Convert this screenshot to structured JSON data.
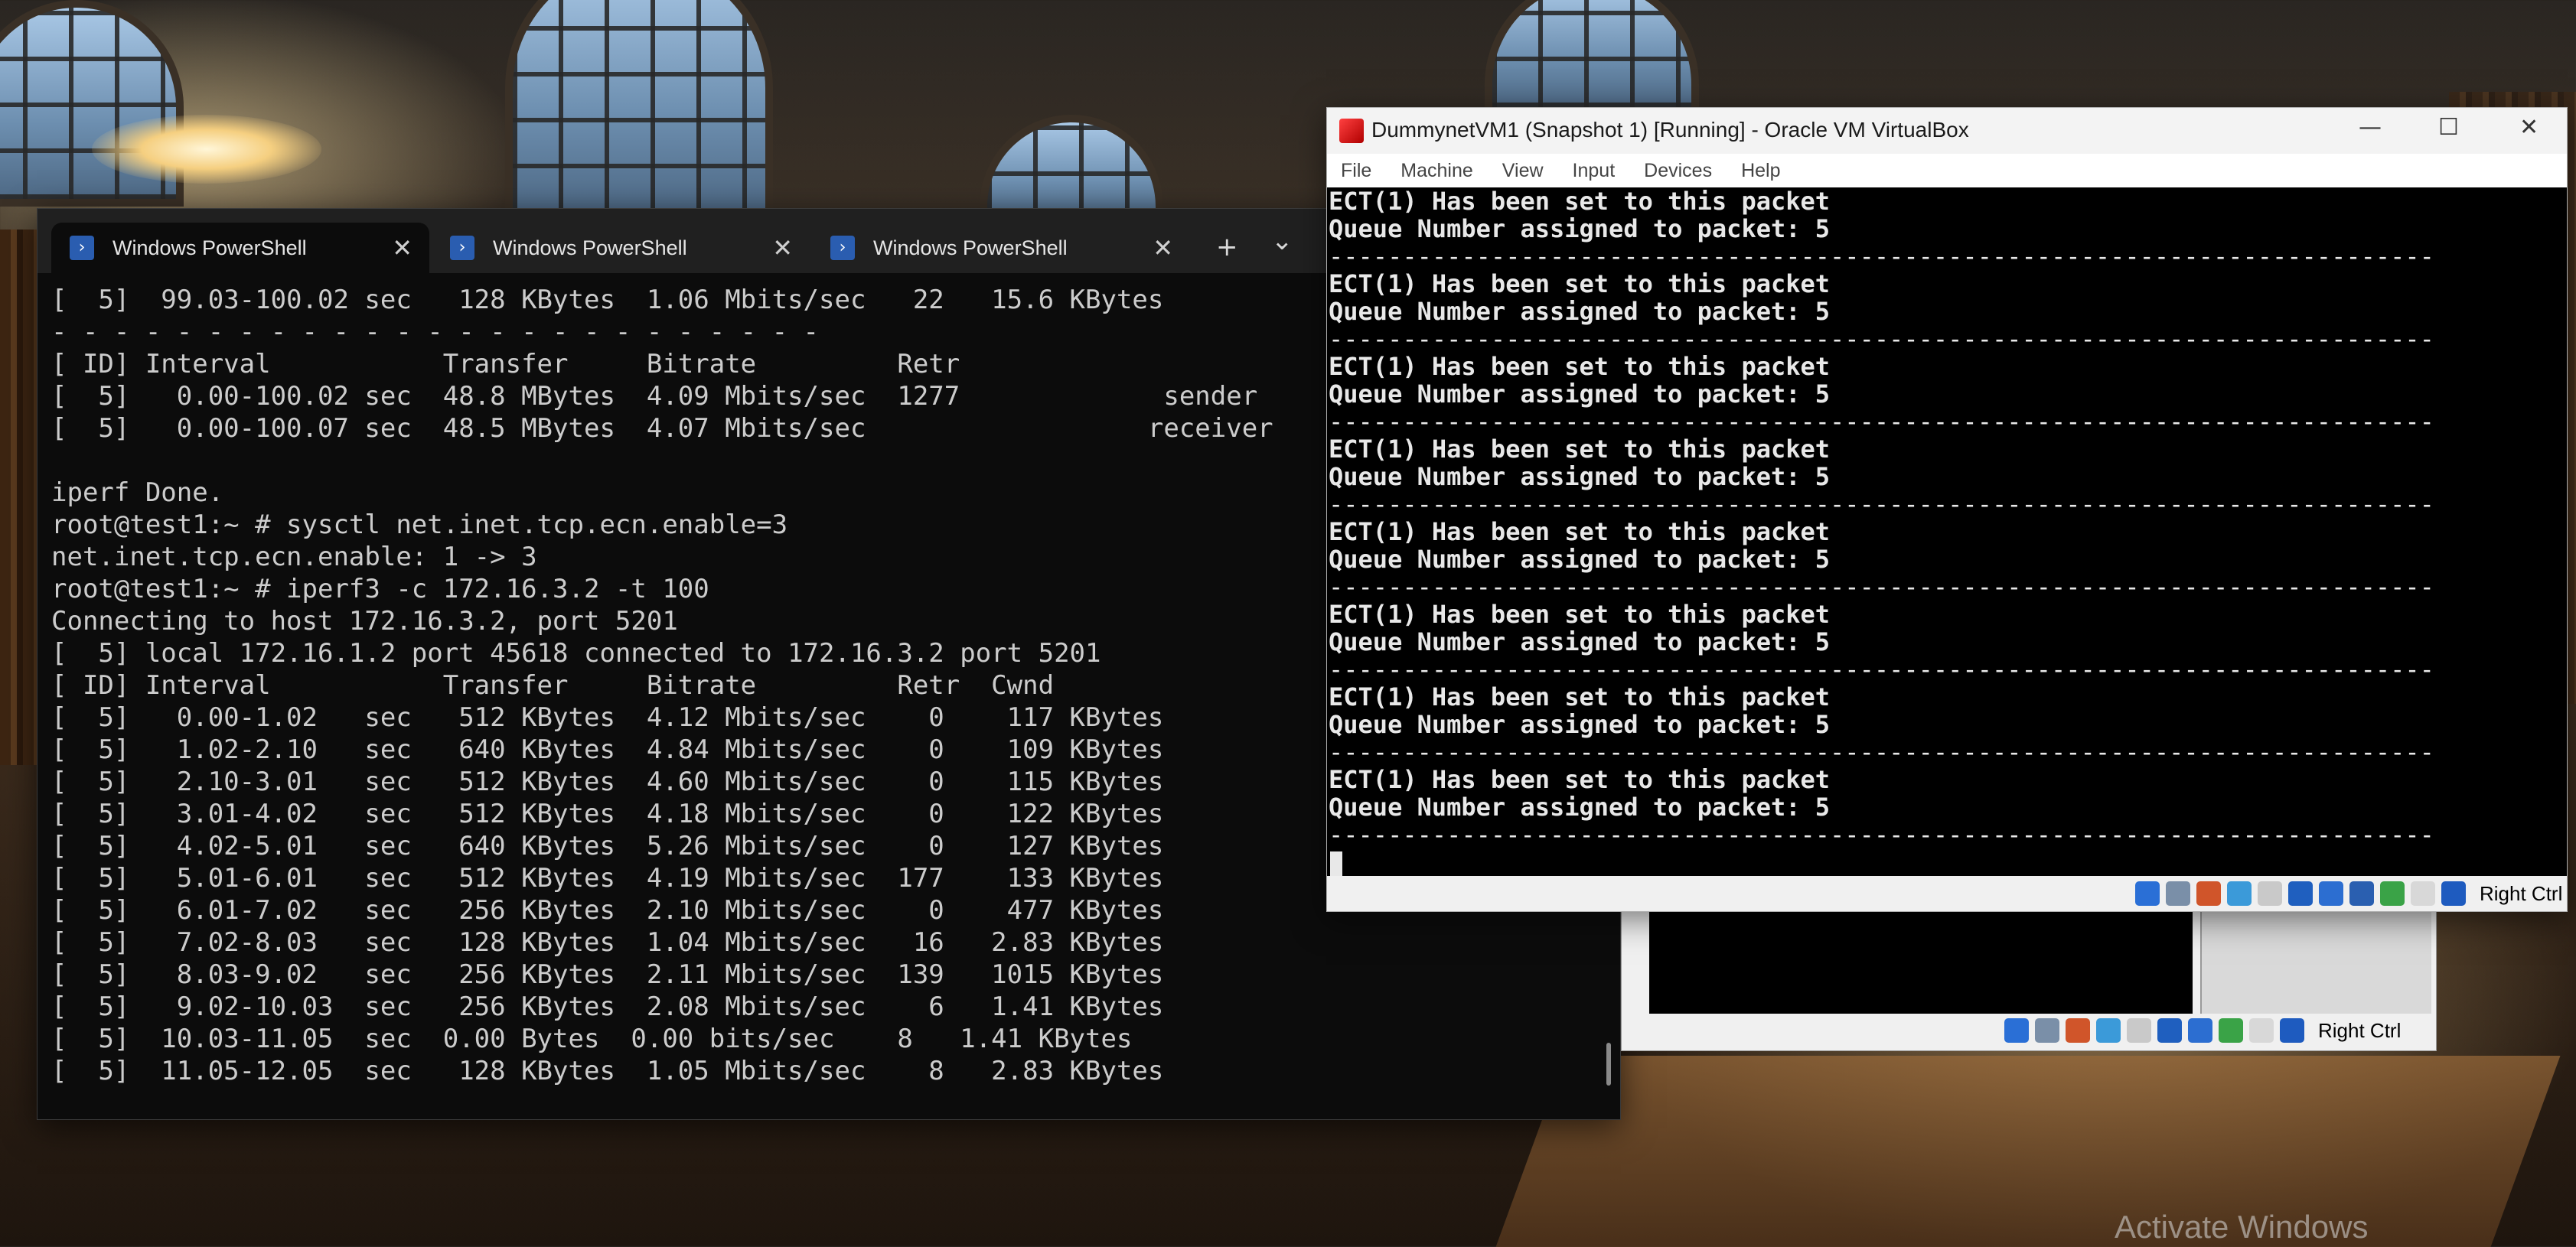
{
  "desktop": {
    "watermark": "Activate Windows"
  },
  "terminal": {
    "tabs": [
      {
        "label": "Windows PowerShell",
        "active": true
      },
      {
        "label": "Windows PowerShell",
        "active": false
      },
      {
        "label": "Windows PowerShell",
        "active": false
      }
    ],
    "new_tab": "+",
    "dropdown": "⌄",
    "lines": [
      "[  5]  99.03-100.02 sec   128 KBytes  1.06 Mbits/sec   22   15.6 KBytes",
      "- - - - - - - - - - - - - - - - - - - - - - - - -",
      "[ ID] Interval           Transfer     Bitrate         Retr",
      "[  5]   0.00-100.02 sec  48.8 MBytes  4.09 Mbits/sec  1277             sender",
      "[  5]   0.00-100.07 sec  48.5 MBytes  4.07 Mbits/sec                  receiver",
      "",
      "iperf Done.",
      "root@test1:~ # sysctl net.inet.tcp.ecn.enable=3",
      "net.inet.tcp.ecn.enable: 1 -> 3",
      "root@test1:~ # iperf3 -c 172.16.3.2 -t 100",
      "Connecting to host 172.16.3.2, port 5201",
      "[  5] local 172.16.1.2 port 45618 connected to 172.16.3.2 port 5201",
      "[ ID] Interval           Transfer     Bitrate         Retr  Cwnd",
      "[  5]   0.00-1.02   sec   512 KBytes  4.12 Mbits/sec    0    117 KBytes",
      "[  5]   1.02-2.10   sec   640 KBytes  4.84 Mbits/sec    0    109 KBytes",
      "[  5]   2.10-3.01   sec   512 KBytes  4.60 Mbits/sec    0    115 KBytes",
      "[  5]   3.01-4.02   sec   512 KBytes  4.18 Mbits/sec    0    122 KBytes",
      "[  5]   4.02-5.01   sec   640 KBytes  5.26 Mbits/sec    0    127 KBytes",
      "[  5]   5.01-6.01   sec   512 KBytes  4.19 Mbits/sec  177    133 KBytes",
      "[  5]   6.01-7.02   sec   256 KBytes  2.10 Mbits/sec    0    477 KBytes",
      "[  5]   7.02-8.03   sec   128 KBytes  1.04 Mbits/sec   16   2.83 KBytes",
      "[  5]   8.03-9.02   sec   256 KBytes  2.11 Mbits/sec  139   1015 KBytes",
      "[  5]   9.02-10.03  sec   256 KBytes  2.08 Mbits/sec    6   1.41 KBytes",
      "[  5]  10.03-11.05  sec  0.00 Bytes  0.00 bits/sec    8   1.41 KBytes",
      "[  5]  11.05-12.05  sec   128 KBytes  1.05 Mbits/sec    8   2.83 KBytes"
    ]
  },
  "vbox": {
    "title": "DummynetVM1 (Snapshot 1) [Running] - Oracle VM VirtualBox",
    "menu": [
      "File",
      "Machine",
      "View",
      "Input",
      "Devices",
      "Help"
    ],
    "console_lines": [
      "ECT(1) Has been set to this packet",
      "Queue Number assigned to packet: 5",
      "---------------------------------------------------------------------------",
      "ECT(1) Has been set to this packet",
      "Queue Number assigned to packet: 5",
      "---------------------------------------------------------------------------",
      "ECT(1) Has been set to this packet",
      "Queue Number assigned to packet: 5",
      "---------------------------------------------------------------------------",
      "ECT(1) Has been set to this packet",
      "Queue Number assigned to packet: 5",
      "---------------------------------------------------------------------------",
      "ECT(1) Has been set to this packet",
      "Queue Number assigned to packet: 5",
      "---------------------------------------------------------------------------",
      "ECT(1) Has been set to this packet",
      "Queue Number assigned to packet: 5",
      "---------------------------------------------------------------------------",
      "ECT(1) Has been set to this packet",
      "Queue Number assigned to packet: 5",
      "---------------------------------------------------------------------------",
      "ECT(1) Has been set to this packet",
      "Queue Number assigned to packet: 5",
      "---------------------------------------------------------------------------"
    ],
    "host_key": "Right Ctrl"
  },
  "vbox_behind": {
    "host_key": "Right Ctrl"
  },
  "status_icons": [
    "hard-disk-icon",
    "optical-drive-icon",
    "audio-icon",
    "network-icon",
    "usb-icon",
    "shared-folder-icon",
    "display-icon",
    "capture-icon",
    "cpu-icon",
    "mouse-integration-icon",
    "keyboard-icon"
  ],
  "colors": {
    "terminal_bg": "#0c0c0c",
    "terminal_text": "#cccccc",
    "powershell_blue": "#2a5db0",
    "vm_screen_bg": "#000000"
  }
}
